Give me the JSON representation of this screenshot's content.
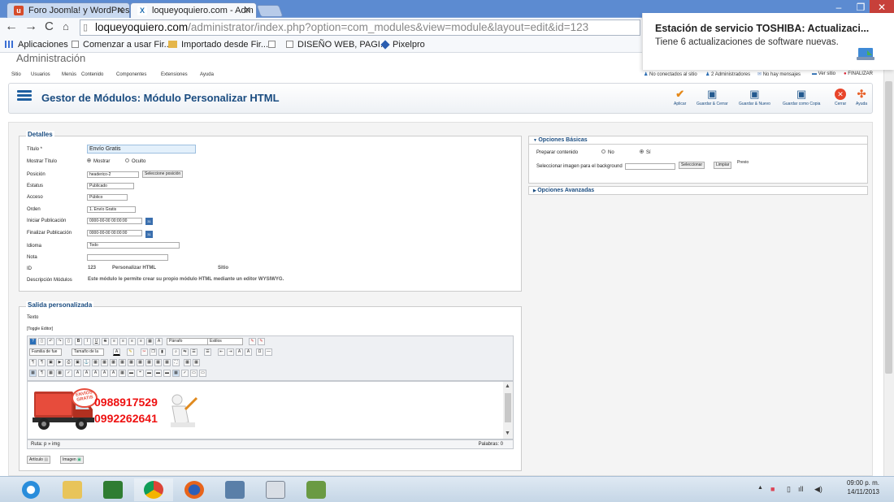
{
  "browser": {
    "tabs": [
      {
        "label": "Foro Joomla! y WordPress",
        "favicon": "u",
        "active": false
      },
      {
        "label": "loqueyoquiero.com - Adm",
        "favicon": "X",
        "active": true
      }
    ],
    "url_domain": "loqueyoquiero.com",
    "url_path": "/administrator/index.php?option=com_modules&view=module&layout=edit&id=123",
    "bookmarks": [
      "Aplicaciones",
      "Comenzar a usar Fir...",
      "Importado desde Fir...",
      "",
      "DISEÑO WEB, PAGI...",
      "Pixelpro"
    ]
  },
  "notification": {
    "title": "Estación de servicio TOSHIBA: Actualizaci...",
    "subtitle": "Tiene 6 actualizaciones de software nuevas."
  },
  "admin": {
    "title": "Administración",
    "menu": [
      "Sitio",
      "Usuarios",
      "Menús",
      "Contenido",
      "Componentes",
      "Extensiones",
      "Ayuda"
    ],
    "status": [
      "No conectados al sitio",
      "2 Administradores",
      "No hay mensajes",
      "Ver sitio",
      "FINALIZAR"
    ],
    "page_title": "Gestor de Módulos: Módulo Personalizar HTML",
    "toolbar": [
      {
        "label": "Aplicar",
        "icon": "check-icon"
      },
      {
        "label": "Guardar & Cerrar",
        "icon": "save-icon"
      },
      {
        "label": "Guardar & Nuevo",
        "icon": "save-new-icon"
      },
      {
        "label": "Guardar como Copia",
        "icon": "save-copy-icon"
      },
      {
        "label": "Cerrar",
        "icon": "close-icon"
      },
      {
        "label": "Ayuda",
        "icon": "help-icon"
      }
    ]
  },
  "details": {
    "legend": "Detalles",
    "title_label": "Título *",
    "title_value": "Envío Gratis",
    "show_title_label": "Mostrar Título",
    "show_options": [
      "Mostrar",
      "Oculto"
    ],
    "position_label": "Posición",
    "position_value": "headerico-2",
    "position_button": "Seleccione posición",
    "status_label": "Estatus",
    "status_value": "Publicado",
    "access_label": "Acceso",
    "access_value": "Público",
    "order_label": "Orden",
    "order_value": "1. Envío Gratis",
    "start_label": "Iniciar Publicación",
    "start_value": "0000-00-00 00:00:00",
    "end_label": "Finalizar Publicación",
    "end_value": "0000-00-00 00:00:00",
    "lang_label": "Idioma",
    "lang_value": "Todo",
    "note_label": "Nota",
    "note_value": "",
    "id_label": "ID",
    "id_value": "123",
    "id_type": "Personalizar HTML",
    "id_site": "Sitio",
    "desc_label": "Descripción Módulos",
    "desc_value": "Este módulo le permite crear su propio módulo HTML mediante un editor WYSIWYG."
  },
  "options": {
    "basic_header": "Opciones Básicas",
    "prepare_label": "Preparar contenido",
    "prepare_options": [
      "No",
      "Sí"
    ],
    "bg_label": "Seleccionar imagen para el background",
    "bg_select": "Seleccionar",
    "bg_clear": "Limpiar",
    "bg_preview": "Previo",
    "advanced_header": "Opciones Avanzadas"
  },
  "custom": {
    "legend": "Salida personalizada",
    "text_label": "Texto",
    "toggle": "[Toggle Editor]",
    "paragraph": "Párrafo",
    "styles": "Estilos",
    "font_family": "Familia de fue",
    "font_size": "Tamaño de la",
    "phone1": "0988917529",
    "phone2": "0992262641",
    "badge": "ENVÍOS GRATIS",
    "path": "Ruta:  p » img",
    "words": "Palabras: 0",
    "btn_article": "Artículo",
    "btn_image": "Imagen"
  },
  "clock": {
    "time": "09:00 p. m.",
    "date": "14/11/2013"
  }
}
